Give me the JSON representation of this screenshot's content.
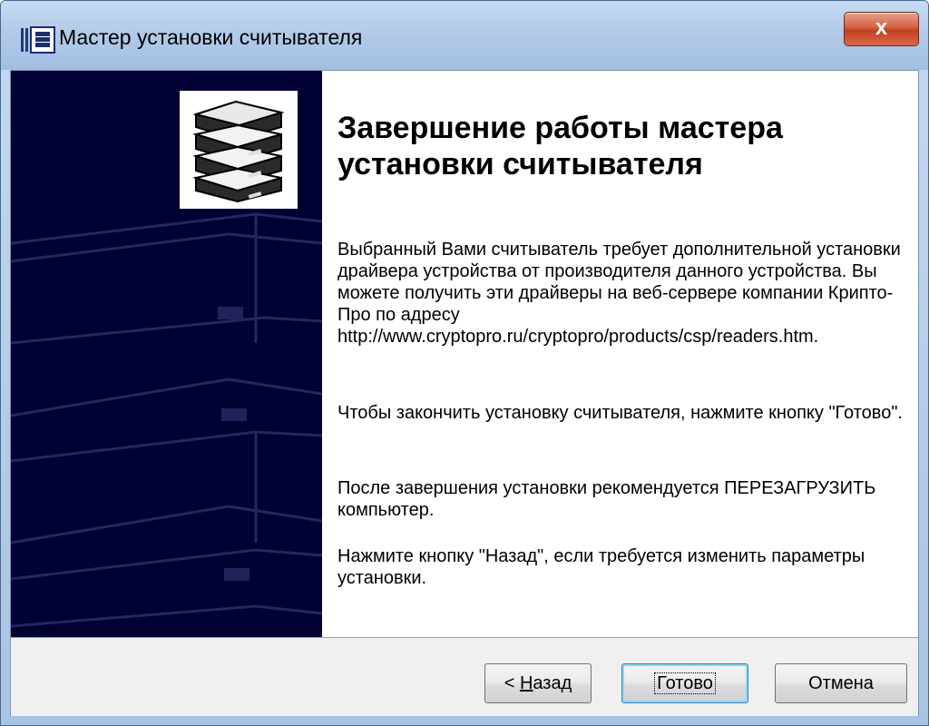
{
  "window": {
    "title": "Мастер установки считывателя",
    "close_label": "x"
  },
  "content": {
    "heading": "Завершение работы мастера установки считывателя",
    "paragraph1": "Выбранный Вами считыватель требует дополнительной установки драйвера устройства от производителя данного устройства. Вы можете получить эти драйверы на веб-сервере компании Крипто-Про по адресу http://www.cryptopro.ru/cryptopro/products/csp/readers.htm.",
    "paragraph2": "Чтобы закончить установку считывателя, нажмите кнопку \"Готово\".",
    "paragraph3": "После завершения установки рекомендуется ПЕРЕЗАГРУЗИТЬ компьютер.",
    "paragraph4": "Нажмите кнопку \"Назад\", если требуется изменить параметры установки."
  },
  "buttons": {
    "back_prefix": "< ",
    "back_accel": "Н",
    "back_rest": "азад",
    "finish_label": "Готово",
    "cancel_label": "Отмена"
  },
  "icons": {
    "app": "wizard-app-icon",
    "logo": "reader-stack-icon",
    "close": "close-icon"
  },
  "colors": {
    "side_panel": "#000033",
    "title_gradient": "#b3cbe8",
    "close_button": "#c0401f",
    "footer": "#f0f0f0"
  }
}
